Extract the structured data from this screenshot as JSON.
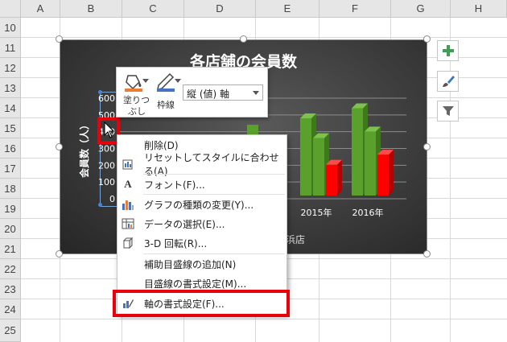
{
  "sheet": {
    "columns": [
      "A",
      "B",
      "C",
      "D",
      "E",
      "F",
      "G",
      "H"
    ],
    "rows": [
      "10",
      "11",
      "12",
      "13",
      "14",
      "15",
      "16",
      "17",
      "18",
      "19",
      "20",
      "21",
      "22",
      "23",
      "24",
      "25"
    ]
  },
  "chart": {
    "title": "各店舗の会員数",
    "y_axis_title": "会員数（人）",
    "y_ticks": [
      "600",
      "500",
      "400",
      "300",
      "200",
      "100",
      "0"
    ],
    "x_labels": [
      "2015年",
      "2016年"
    ],
    "legend_partial": "横浜店",
    "colors": {
      "green": "#5aa02c",
      "red": "#ff0000",
      "background": "#3c3c3c"
    }
  },
  "chart_data": {
    "type": "bar",
    "title": "各店舗の会員数",
    "ylabel": "会員数（人）",
    "ylim": [
      0,
      600
    ],
    "categories": [
      "2015年",
      "2016年"
    ],
    "series": [
      {
        "values": [
          480,
          540
        ]
      },
      {
        "values": [
          400,
          440
        ]
      },
      {
        "values": [
          280,
          340
        ]
      }
    ]
  },
  "side_buttons": [
    "plus-icon",
    "brush-icon",
    "filter-icon"
  ],
  "minibar": {
    "fill_label_1": "塗りつ",
    "fill_label_2": "ぶし",
    "outline_label": "枠線",
    "element_select": "縦 (値) 軸"
  },
  "context_menu": {
    "items": [
      {
        "label": "削除(D)",
        "icon": "none"
      },
      {
        "label": "リセットしてスタイルに合わせる(A)",
        "icon": "reset-style-icon"
      },
      {
        "label": "フォント(F)...",
        "icon": "font-icon"
      },
      {
        "label": "グラフの種類の変更(Y)...",
        "icon": "change-chart-type-icon"
      },
      {
        "label": "データの選択(E)...",
        "icon": "select-data-icon"
      },
      {
        "label": "3-D 回転(R)...",
        "icon": "3d-rotation-icon"
      },
      {
        "label": "補助目盛線の追加(N)",
        "icon": "none"
      },
      {
        "label": "目盛線の書式設定(M)...",
        "icon": "none"
      },
      {
        "label": "軸の書式設定(F)...",
        "icon": "format-axis-icon"
      }
    ]
  },
  "highlight_color": "#e8000b"
}
